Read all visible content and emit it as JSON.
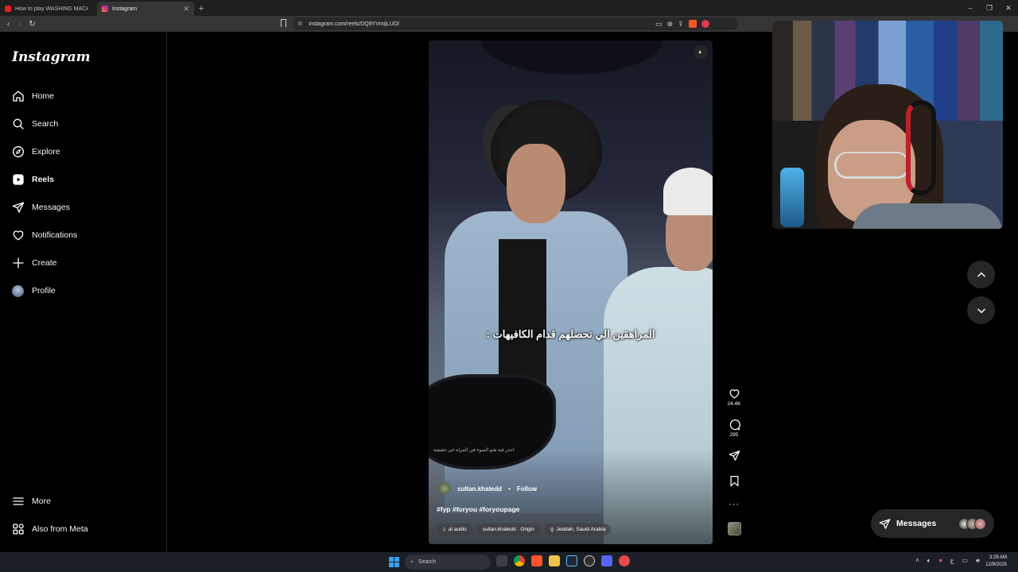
{
  "browser": {
    "tabs": [
      {
        "title": "How to play WASHING MACHINE HI...",
        "active": false
      },
      {
        "title": "Instagram",
        "active": true
      }
    ],
    "url": "instagram.com/reels/DQ9YVmijLUO/"
  },
  "sidebar": {
    "logo": "Instagram",
    "items": [
      {
        "label": "Home",
        "icon": "home-icon"
      },
      {
        "label": "Search",
        "icon": "search-icon"
      },
      {
        "label": "Explore",
        "icon": "compass-icon"
      },
      {
        "label": "Reels",
        "icon": "reels-icon"
      },
      {
        "label": "Messages",
        "icon": "send-icon"
      },
      {
        "label": "Notifications",
        "icon": "heart-icon"
      },
      {
        "label": "Create",
        "icon": "plus-icon"
      },
      {
        "label": "Profile",
        "icon": "avatar"
      }
    ],
    "bottom": [
      {
        "label": "More",
        "icon": "menu-icon"
      },
      {
        "label": "Also from Meta",
        "icon": "meta-grid-icon"
      }
    ]
  },
  "reel": {
    "subtitle": "المراهقين الي تحصلهم قدام الكافيهات :",
    "mirror_text": "احذر فيه هنو السوء في المراة غير حقيقية",
    "username": "sultan.khaledd",
    "dot": "•",
    "follow_label": "Follow",
    "caption": "#fyp #foryou #foryoupage",
    "audio": "al audio",
    "origin": "sultan.khaledd · Origin",
    "location": "Jeddah, Saudi Arabia"
  },
  "actions": {
    "likes": "24.4K",
    "comments": "295"
  },
  "messages_pill": {
    "label": "Messages"
  },
  "taskbar": {
    "search_placeholder": "Search",
    "time": "3:29 AM",
    "date": "12/9/2025"
  },
  "colors": {
    "background": "#000000",
    "sidebar_border": "#262626",
    "pill": "#262626"
  }
}
